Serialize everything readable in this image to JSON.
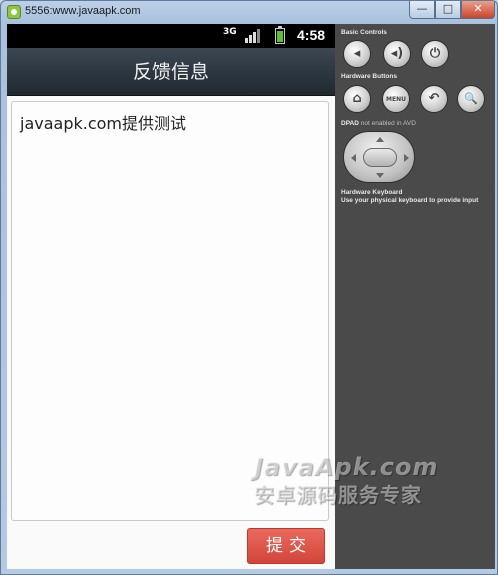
{
  "window": {
    "title": "5556:www.javaapk.com",
    "minimize_label": "—",
    "maximize_label": "□",
    "close_label": "✕"
  },
  "statusbar": {
    "network": "3G",
    "time": "4:58",
    "icons": [
      "3g-icon",
      "signal-icon",
      "battery-icon"
    ]
  },
  "app": {
    "title": "反馈信息",
    "feedback_value": "javaapk.com提供测试",
    "submit_label": "提交"
  },
  "panel": {
    "basic_controls_label": "Basic Controls",
    "basic_controls": [
      {
        "name": "volume-down-icon",
        "glyph": "◂"
      },
      {
        "name": "volume-up-icon",
        "glyph": "◂)"
      },
      {
        "name": "power-icon",
        "glyph": "⏻"
      }
    ],
    "hardware_buttons_label": "Hardware Buttons",
    "hardware_buttons": [
      {
        "name": "home-icon",
        "glyph": "⌂"
      },
      {
        "name": "menu-icon",
        "glyph": "MENU"
      },
      {
        "name": "back-icon",
        "glyph": "↶"
      },
      {
        "name": "search-icon",
        "glyph": "🔍"
      }
    ],
    "dpad_label": "DPAD",
    "dpad_note": "not enabled in AVD",
    "keyboard_label": "Hardware Keyboard",
    "keyboard_note": "Use your physical keyboard to provide input"
  },
  "watermark": {
    "line1": "JavaApk.com",
    "line2": "安卓源码服务专家"
  }
}
